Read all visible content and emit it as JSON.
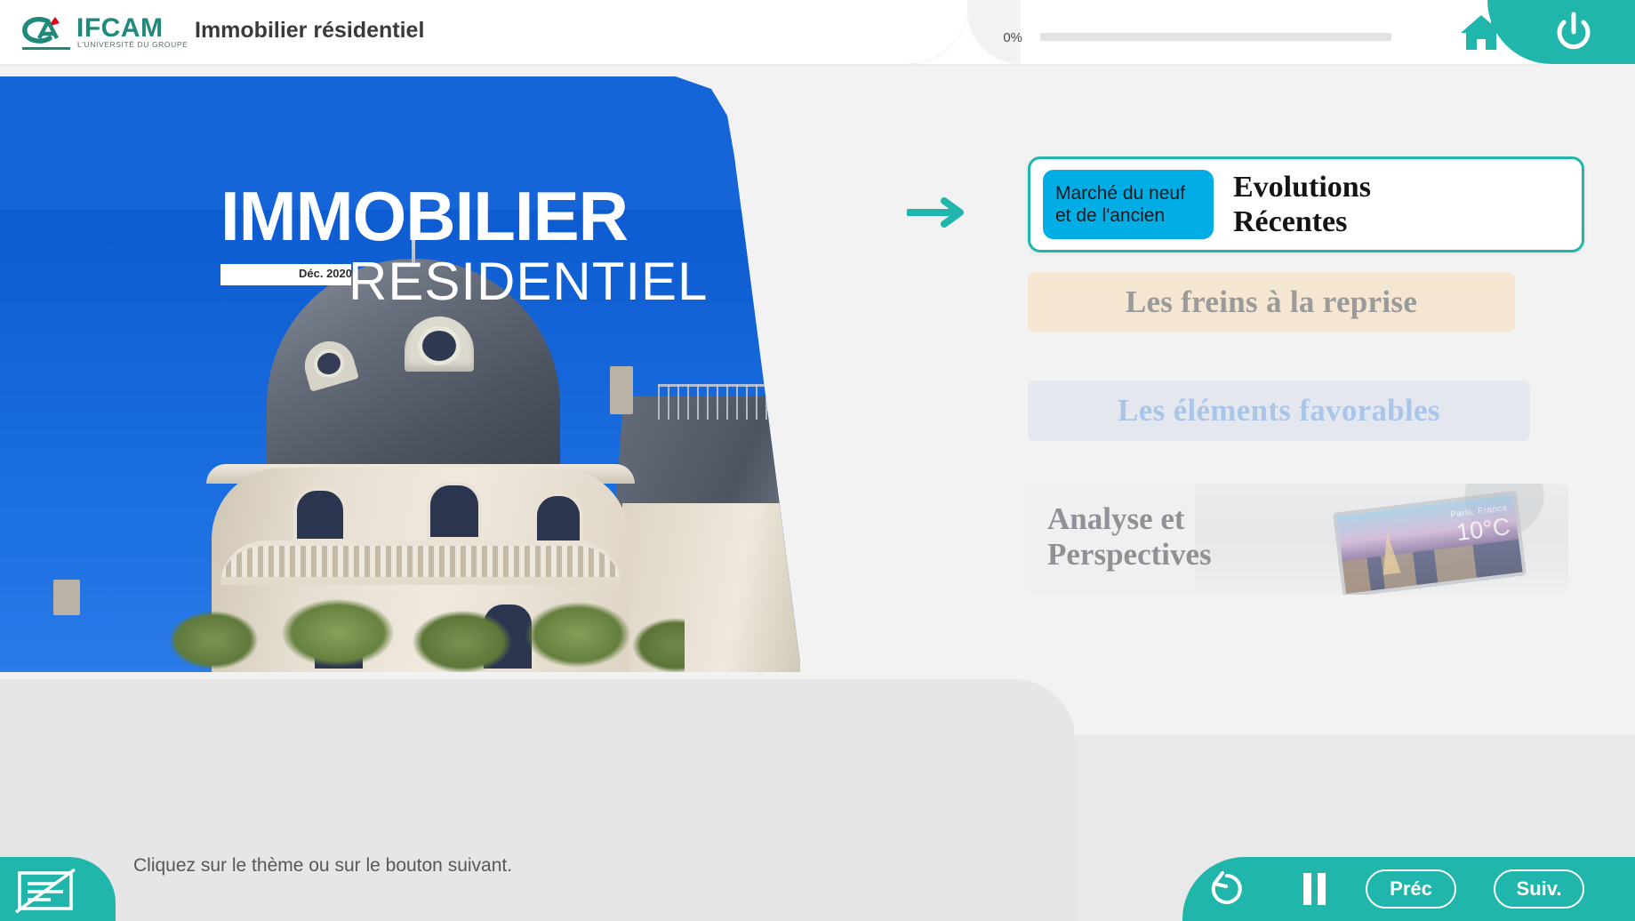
{
  "header": {
    "logo_text": "IFCAM",
    "logo_tagline": "L'UNIVERSITÉ DU GROUPE",
    "logo_mark": "credit-agricole-ca-logo",
    "course_title": "Immobilier résidentiel",
    "progress_percent_label": "0%",
    "progress_value": 0,
    "home_icon": "home-icon",
    "power_icon": "power-icon",
    "teal": "#21b6ac"
  },
  "cover": {
    "title": "IMMOBILIER",
    "subtitle": "RESIDENTIEL",
    "date": "Déc. 2020",
    "background_color": "#1565d8",
    "photo_description": "haussmann-building-dome-photo"
  },
  "menu": {
    "arrow_icon": "arrow-right-icon",
    "items": [
      {
        "badge": "Marché du neuf\net de l'ancien",
        "badge_line1": "Marché du neuf",
        "badge_line2": "et de l'ancien",
        "title_line1": "Evolutions",
        "title_line2": "Récentes",
        "state": "active",
        "badge_color": "#00aee5",
        "border_color": "#21b6ac"
      },
      {
        "label": "Les freins à la reprise",
        "state": "locked",
        "background_color": "#f5e6d2",
        "text_color": "#9a9a9a"
      },
      {
        "label": "Les éléments favorables",
        "state": "locked",
        "background_color": "#e4e8ee",
        "text_color": "#a9c6ea"
      },
      {
        "label_line1": "Analyse et",
        "label_line2": "Perspectives",
        "state": "locked",
        "background_color": "#f0f0f0",
        "text_color": "#8e9196",
        "thumbnail": "laptop-paris-weather-photo",
        "thumbnail_city": "Paris, France",
        "thumbnail_temp": "10°C"
      }
    ]
  },
  "footer": {
    "instruction": "Cliquez sur le thème ou sur le bouton suivant.",
    "cc_icon": "closed-captions-off-icon",
    "replay_icon": "replay-icon",
    "pause_icon": "pause-icon",
    "prev_label": "Préc",
    "next_label": "Suiv.",
    "bar_color": "#21b6ac"
  }
}
